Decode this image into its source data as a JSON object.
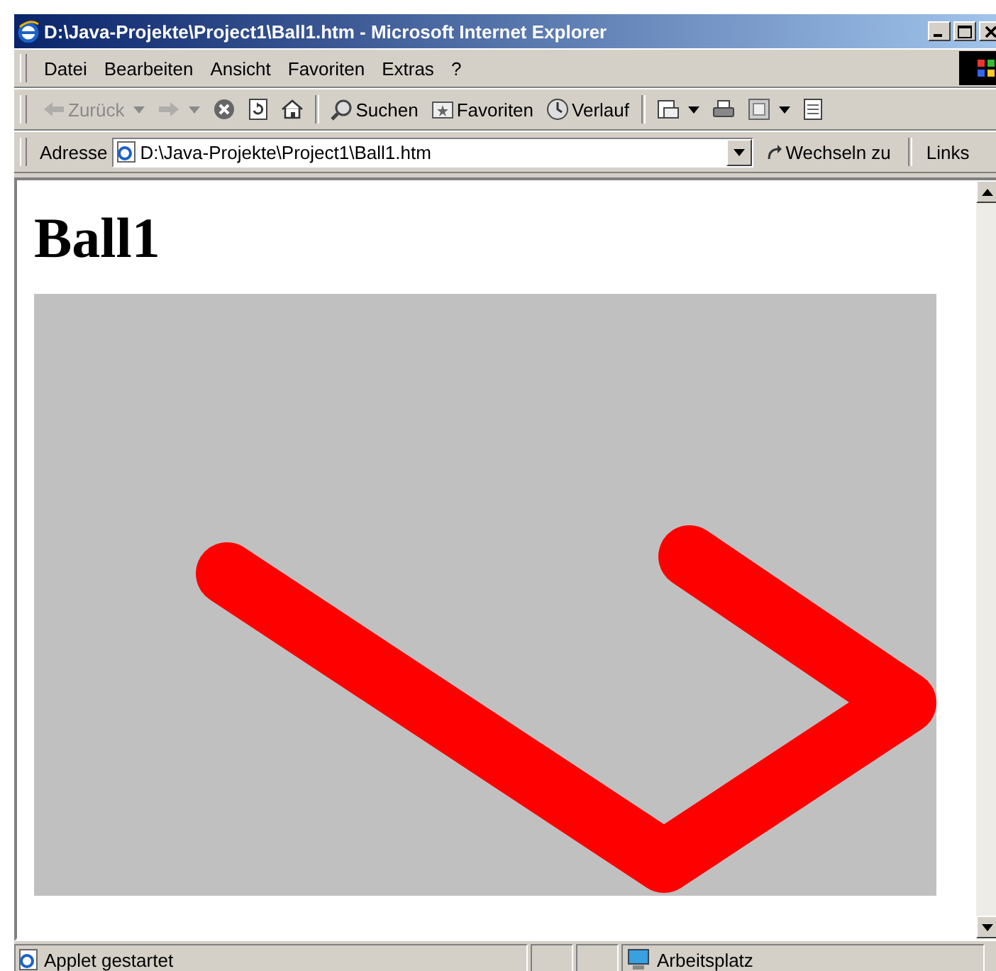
{
  "window": {
    "title": "D:\\Java-Projekte\\Project1\\Ball1.htm - Microsoft Internet Explorer"
  },
  "menu": [
    {
      "label": "Datei"
    },
    {
      "label": "Bearbeiten"
    },
    {
      "label": "Ansicht"
    },
    {
      "label": "Favoriten"
    },
    {
      "label": "Extras"
    },
    {
      "label": "?"
    }
  ],
  "toolbar": [
    {
      "kind": "back",
      "label": "Zurück",
      "disabled": true,
      "dropdown": true
    },
    {
      "kind": "forward",
      "disabled": true,
      "dropdown": true
    },
    {
      "kind": "stop",
      "disabled": false,
      "dropdown": false
    },
    {
      "kind": "refresh",
      "disabled": false,
      "dropdown": false
    },
    {
      "kind": "home",
      "disabled": false,
      "dropdown": false
    },
    {
      "kind": "search",
      "label": "Suchen",
      "disabled": false,
      "dropdown": false
    },
    {
      "kind": "favorites",
      "label": "Favoriten",
      "disabled": false,
      "dropdown": false
    },
    {
      "kind": "history",
      "label": "Verlauf",
      "disabled": false,
      "dropdown": false
    },
    {
      "kind": "mail",
      "disabled": false,
      "dropdown": true
    },
    {
      "kind": "print",
      "disabled": false,
      "dropdown": false
    },
    {
      "kind": "edit",
      "disabled": false,
      "dropdown": true
    },
    {
      "kind": "discuss",
      "disabled": false,
      "dropdown": false
    }
  ],
  "address_bar": {
    "label": "Adresse",
    "value": "D:\\Java-Projekte\\Project1\\Ball1.htm",
    "go_label": "Wechseln zu",
    "links_label": "Links"
  },
  "page": {
    "heading": "Ball1"
  },
  "status_bar": {
    "message": "Applet gestartet",
    "zone": "Arbeitsplatz"
  }
}
